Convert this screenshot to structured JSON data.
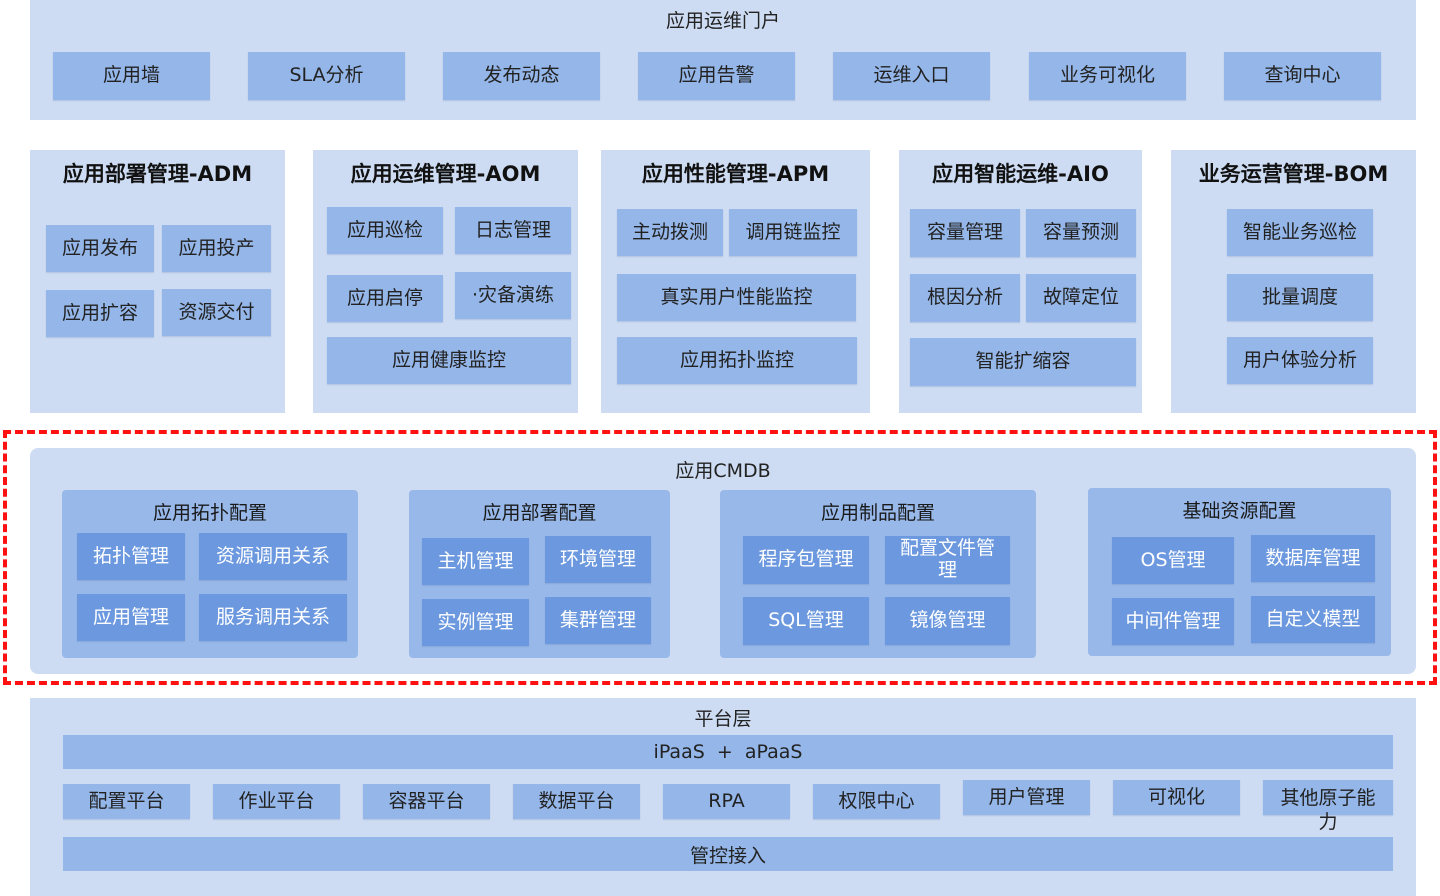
{
  "portal": {
    "title": "应用运维门户",
    "items": [
      "应用墙",
      "SLA分析",
      "发布动态",
      "应用告警",
      "运维入口",
      "业务可视化",
      "查询中心"
    ]
  },
  "modules": [
    {
      "title": "应用部署管理-ADM",
      "items": [
        "应用发布",
        "应用投产",
        "应用扩容",
        "资源交付"
      ]
    },
    {
      "title": "应用运维管理-AOM",
      "items": [
        "应用巡检",
        "日志管理",
        "应用启停",
        "·灾备演练",
        "应用健康监控"
      ]
    },
    {
      "title": "应用性能管理-APM",
      "items": [
        "主动拨测",
        "调用链监控",
        "真实用户性能监控",
        "应用拓扑监控"
      ]
    },
    {
      "title": "应用智能运维-AIO",
      "items": [
        "容量管理",
        "容量预测",
        "根因分析",
        "故障定位",
        "智能扩缩容"
      ]
    },
    {
      "title": "业务运营管理-BOM",
      "items": [
        "智能业务巡检",
        "批量调度",
        "用户体验分析"
      ]
    }
  ],
  "cmdb": {
    "title": "应用CMDB",
    "highlight_color": "#ff1111",
    "groups": [
      {
        "title": "应用拓扑配置",
        "items": [
          "拓扑管理",
          "资源调用关系",
          "应用管理",
          "服务调用关系"
        ]
      },
      {
        "title": "应用部署配置",
        "items": [
          "主机管理",
          "环境管理",
          "实例管理",
          "集群管理"
        ]
      },
      {
        "title": "应用制品配置",
        "items": [
          "程序包管理",
          "配置文件管理",
          "SQL管理",
          "镜像管理"
        ]
      },
      {
        "title": "基础资源配置",
        "items": [
          "OS管理",
          "数据库管理",
          "中间件管理",
          "自定义模型"
        ]
      }
    ]
  },
  "platform": {
    "title": "平台层",
    "paas_bar": "iPaaS  +  aPaaS",
    "items": [
      "配置平台",
      "作业平台",
      "容器平台",
      "数据平台",
      "RPA",
      "权限中心",
      "用户管理",
      "可视化",
      "其他原子能力"
    ],
    "access_bar": "管控接入"
  }
}
